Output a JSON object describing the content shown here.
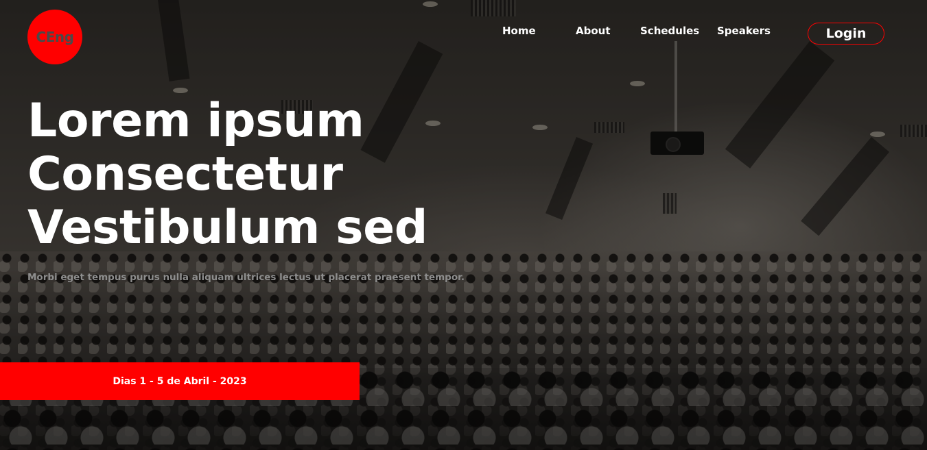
{
  "logo": {
    "text": "CEng"
  },
  "nav": {
    "items": [
      {
        "label": "Home"
      },
      {
        "label": "About"
      },
      {
        "label": "Schedules"
      },
      {
        "label": "Speakers"
      }
    ],
    "login_label": "Login"
  },
  "hero": {
    "headline_lines": [
      "Lorem ipsum",
      "Consectetur",
      "Vestibulum sed"
    ],
    "subtitle": "Morbi eget tempus purus nulla aliquam ultrices lectus ut placerat praesent tempor.",
    "date_label": "Dias 1 - 5 de Abril - 2023",
    "background_image": "lecture-hall-audience-photo"
  },
  "colors": {
    "accent": "#ff0000",
    "logo_text": "#4a4a4a",
    "subtitle": "#8e8e8e",
    "text": "#ffffff"
  }
}
